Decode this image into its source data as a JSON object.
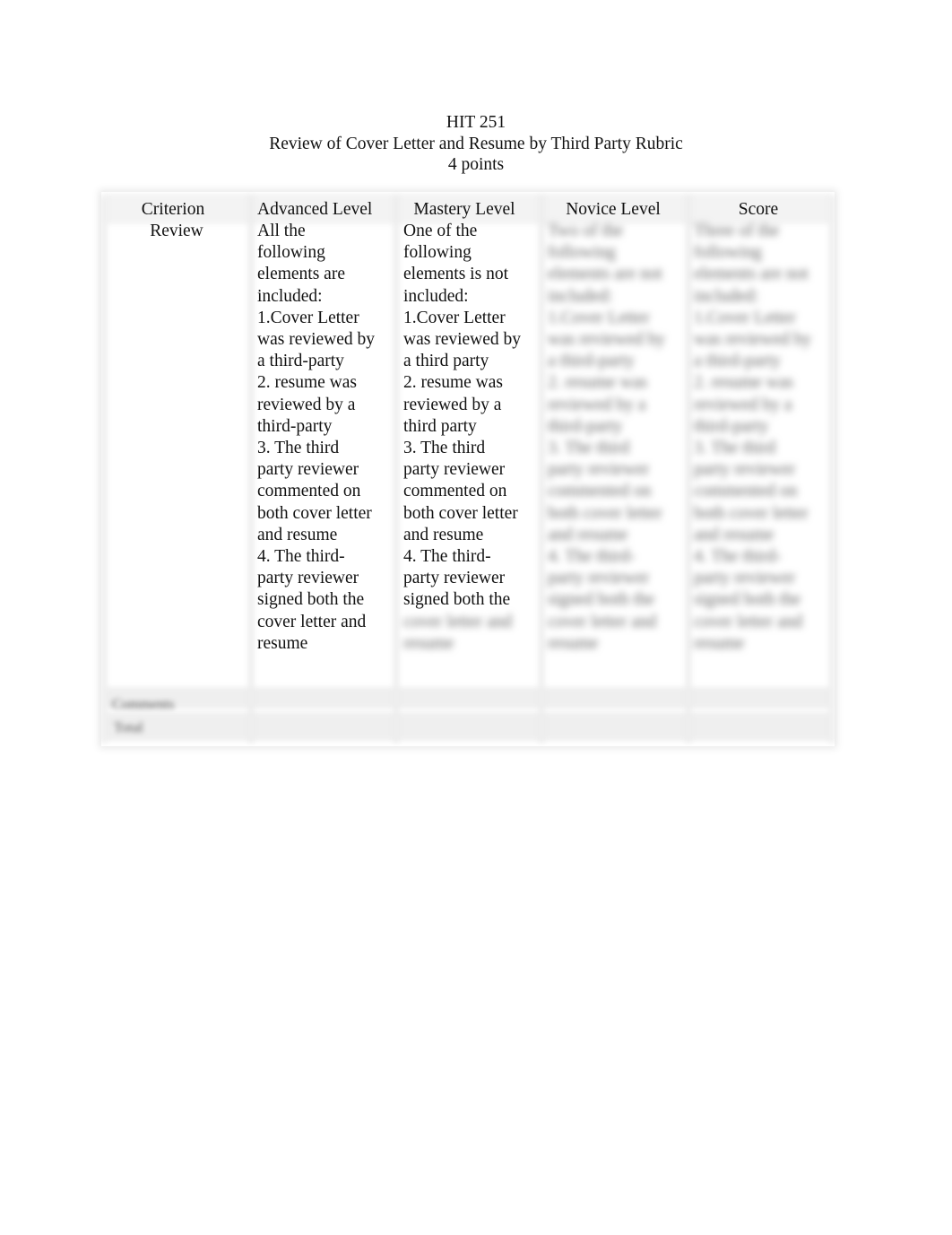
{
  "document": {
    "course_code": "HIT 251",
    "title": "Review of Cover Letter and Resume by Third Party Rubric",
    "points": "4 points"
  },
  "rubric": {
    "headers": {
      "criterion": "Criterion",
      "advanced": "Advanced Level",
      "mastery": "Mastery Level",
      "novice": "Novice Level",
      "score": "Score"
    },
    "criterion_name": "Review",
    "advanced_text": [
      "All the",
      "following",
      "elements are",
      "included:",
      "1.Cover Letter",
      "was reviewed by",
      "a third-party",
      "2. resume was",
      "reviewed by a",
      "third-party",
      "3. The third",
      "party reviewer",
      "commented on",
      "both cover letter",
      "and resume",
      "4. The third-",
      "party reviewer",
      "signed both the",
      "cover letter and",
      "resume"
    ],
    "mastery_text": [
      "One of the",
      "following",
      "elements is not",
      "included:",
      "1.Cover Letter",
      "was reviewed by",
      "a third party",
      "2. resume was",
      "reviewed by a",
      "third party",
      "3. The third",
      "party reviewer",
      "commented on",
      "both cover letter",
      "and resume",
      "4. The third-",
      "party reviewer",
      "signed both the"
    ],
    "mastery_blurred_text": [
      "cover letter and",
      "resume"
    ],
    "novice_blurred_text": [
      "Two of the",
      "following",
      "elements are not",
      "included:",
      "1.Cover Letter",
      "was reviewed by",
      "a third-party",
      "2. resume was",
      "reviewed by a",
      "third-party",
      "3. The third",
      "party reviewer",
      "commented on",
      "both cover letter",
      "and resume",
      "4. The third-",
      "party reviewer",
      "signed both the",
      "cover letter and",
      "resume"
    ],
    "score_blurred_text": [
      "Three of the",
      "following",
      "elements are not",
      "included:",
      "1.Cover Letter",
      "was reviewed by",
      "a third-party",
      "2. resume was",
      "reviewed by a",
      "third-party",
      "3. The third",
      "party reviewer",
      "commented on",
      "both cover letter",
      "and resume",
      "4. The third-",
      "party reviewer",
      "signed both the",
      "cover letter and",
      "resume"
    ],
    "footer_rows": {
      "comments_label": "Comments",
      "total_label": "Total"
    }
  }
}
